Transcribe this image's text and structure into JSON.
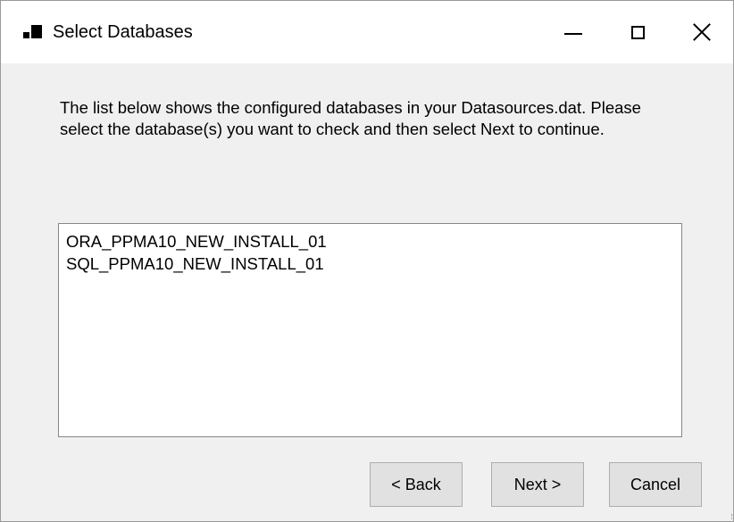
{
  "window": {
    "title": "Select Databases",
    "icon": "app-window-icon",
    "controls": {
      "minimize_icon": "minimize-icon",
      "maximize_icon": "maximize-icon",
      "close_icon": "close-icon"
    }
  },
  "content": {
    "instructions": "The list below shows the configured databases in your Datasources.dat. Please select the database(s) you want to check and then select Next to continue.",
    "databases": [
      "ORA_PPMA10_NEW_INSTALL_01",
      "SQL_PPMA10_NEW_INSTALL_01"
    ]
  },
  "buttons": {
    "back": "< Back",
    "next": "Next >",
    "cancel": "Cancel"
  }
}
